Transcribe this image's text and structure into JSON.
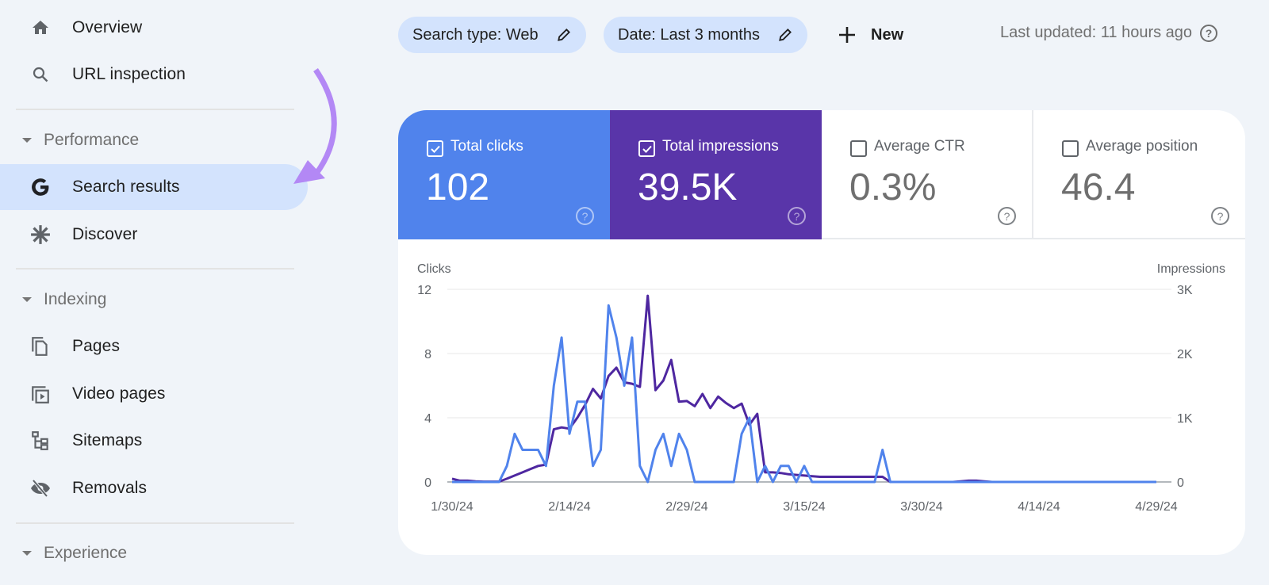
{
  "sidebar": {
    "items": [
      {
        "label": "Overview",
        "icon": "home-icon"
      },
      {
        "label": "URL inspection",
        "icon": "search-icon"
      }
    ],
    "sections": [
      {
        "label": "Performance",
        "items": [
          {
            "label": "Search results",
            "icon": "google-g-icon",
            "active": true
          },
          {
            "label": "Discover",
            "icon": "asterisk-icon"
          }
        ]
      },
      {
        "label": "Indexing",
        "items": [
          {
            "label": "Pages",
            "icon": "pages-icon"
          },
          {
            "label": "Video pages",
            "icon": "video-pages-icon"
          },
          {
            "label": "Sitemaps",
            "icon": "sitemap-icon"
          },
          {
            "label": "Removals",
            "icon": "eye-off-icon"
          }
        ]
      },
      {
        "label": "Experience",
        "items": []
      }
    ]
  },
  "toolbar": {
    "filters": [
      {
        "label": "Search type: Web"
      },
      {
        "label": "Date: Last 3 months"
      }
    ],
    "new_label": "New",
    "last_updated": "Last updated: 11 hours ago"
  },
  "metrics": [
    {
      "label": "Total clicks",
      "value": "102",
      "checked": true,
      "color": "#5083ec"
    },
    {
      "label": "Total impressions",
      "value": "39.5K",
      "checked": true,
      "color": "#5935a9"
    },
    {
      "label": "Average CTR",
      "value": "0.3%",
      "checked": false
    },
    {
      "label": "Average position",
      "value": "46.4",
      "checked": false
    }
  ],
  "annotation_color": "#b388f5",
  "chart_data": {
    "type": "line",
    "xlabel": "",
    "ylabel_left": "Clicks",
    "ylabel_right": "Impressions",
    "y_left_ticks": [
      "0",
      "4",
      "8",
      "12"
    ],
    "y_left_lim": [
      0,
      12
    ],
    "y_right_ticks": [
      "0",
      "1K",
      "2K",
      "3K"
    ],
    "y_right_lim": [
      0,
      3000
    ],
    "x_tick_labels": [
      "1/30/24",
      "2/14/24",
      "2/29/24",
      "3/15/24",
      "3/30/24",
      "4/14/24",
      "4/29/24"
    ],
    "x_tick_days": [
      0,
      15,
      30,
      45,
      60,
      75,
      90
    ],
    "x_range_days": [
      0,
      90
    ],
    "grid": true,
    "series": [
      {
        "name": "Clicks",
        "axis": "left",
        "color": "#5083ec",
        "values": [
          0,
          0,
          0,
          0,
          0,
          0,
          0,
          1,
          3,
          2,
          2,
          2,
          1,
          6,
          9,
          3,
          5,
          5,
          1,
          2,
          11,
          9,
          6,
          9,
          1,
          0,
          2,
          3,
          1,
          3,
          2,
          0,
          0,
          0,
          0,
          0,
          0,
          3,
          4,
          0,
          1,
          0,
          1,
          1,
          0,
          1,
          0,
          0,
          0,
          0,
          0,
          0,
          0,
          0,
          0,
          2,
          0,
          0,
          0,
          0,
          0,
          0,
          0,
          0,
          0,
          0,
          0,
          0,
          0,
          0,
          0,
          0,
          0,
          0,
          0,
          0,
          0,
          0,
          0,
          0,
          0,
          0,
          0,
          0,
          0,
          0,
          0,
          0,
          0,
          0,
          0
        ]
      },
      {
        "name": "Impressions",
        "axis": "right",
        "color": "#4e27a0",
        "values": [
          50,
          20,
          20,
          10,
          5,
          5,
          5,
          50,
          100,
          150,
          200,
          250,
          270,
          820,
          850,
          830,
          1000,
          1200,
          1450,
          1300,
          1650,
          1780,
          1550,
          1530,
          1480,
          2900,
          1430,
          1580,
          1900,
          1250,
          1260,
          1180,
          1370,
          1150,
          1330,
          1230,
          1150,
          1220,
          890,
          1060,
          150,
          150,
          140,
          120,
          110,
          100,
          90,
          80,
          80,
          80,
          80,
          80,
          80,
          80,
          80,
          80,
          0,
          0,
          0,
          0,
          0,
          0,
          0,
          0,
          0,
          10,
          20,
          20,
          10,
          0,
          0,
          0,
          0,
          0,
          0,
          0,
          0,
          0,
          0,
          0,
          0,
          0,
          0,
          0,
          0,
          0,
          0,
          0,
          0,
          0,
          0
        ]
      }
    ]
  }
}
